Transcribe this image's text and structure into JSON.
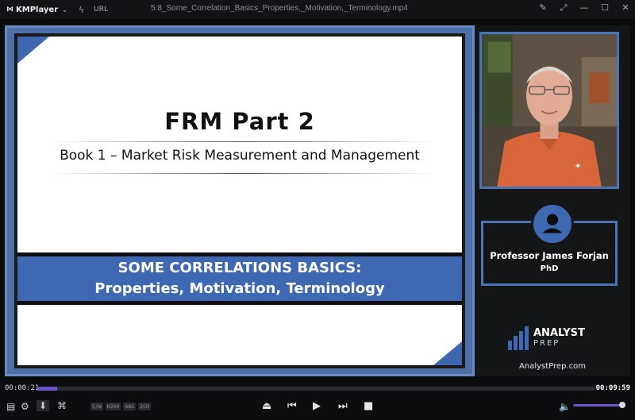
{
  "titlebar": {
    "app_name": "KMPlayer",
    "url_label": "URL",
    "filename": "5.8_Some_Correlation_Basics_Properties,_Motivation,_Terminology.mp4"
  },
  "slide": {
    "title": "FRM Part 2",
    "subtitle": "Book 1 – Market Risk Measurement and Management",
    "topic_line1": "SOME CORRELATIONS BASICS:",
    "topic_line2": "Properties, Motivation, Terminology"
  },
  "presenter": {
    "name": "Professor James Forjan",
    "degree": "PhD"
  },
  "brand": {
    "logo_top": "ANALYST",
    "logo_bottom": "PREP",
    "website": "AnalystPrep.com"
  },
  "playback": {
    "current_time": "00:00:21",
    "total_time": "00:09:59",
    "progress": 0.035,
    "volume": 1.0
  },
  "badges": [
    "S/W",
    "H264",
    "AAC",
    "2CH"
  ],
  "colors": {
    "accent": "#6f56c7",
    "slide_blue": "#3f68b2",
    "frame_blue": "#4a74b8"
  }
}
